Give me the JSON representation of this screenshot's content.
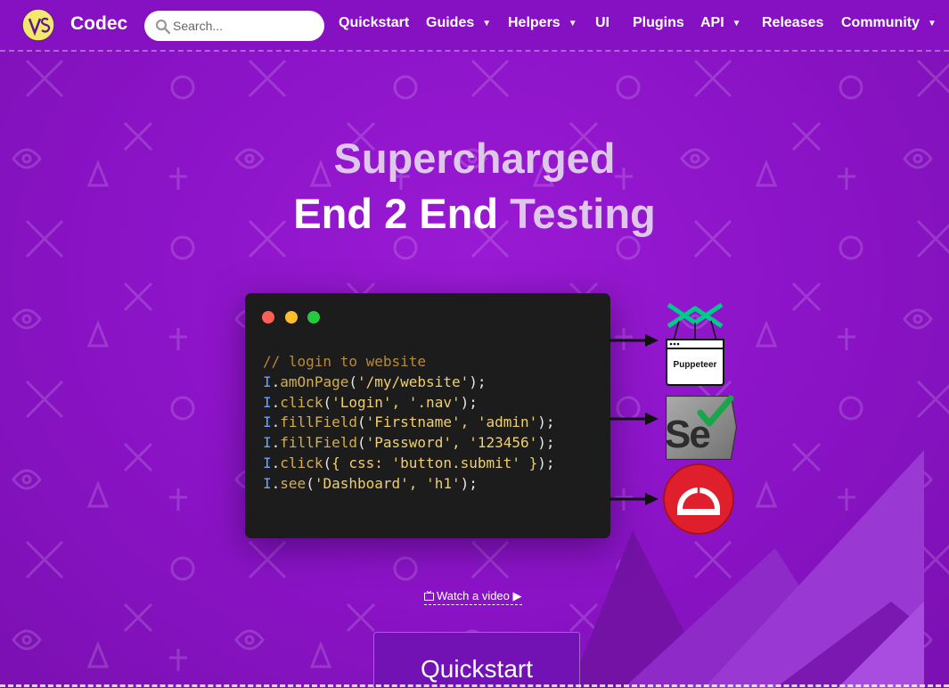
{
  "brand": {
    "name": "Codec"
  },
  "search": {
    "placeholder": "Search..."
  },
  "nav": {
    "items": [
      {
        "label": "Quickstart",
        "dropdown": false
      },
      {
        "label": "Guides",
        "dropdown": true
      },
      {
        "label": "Helpers",
        "dropdown": true
      },
      {
        "label": "UI",
        "dropdown": false
      },
      {
        "label": "Plugins",
        "dropdown": false
      },
      {
        "label": "API",
        "dropdown": true
      },
      {
        "label": "Releases",
        "dropdown": false
      },
      {
        "label": "Community",
        "dropdown": true
      }
    ],
    "caret": "▼"
  },
  "hero": {
    "line1": "Supercharged",
    "line2_part1": "End 2 End",
    "line2_part2": "Testing"
  },
  "code": {
    "comment": "// login to website",
    "lines": [
      {
        "obj": "I",
        "fn": "amOnPage",
        "args": "'/my/website'"
      },
      {
        "obj": "I",
        "fn": "click",
        "args": "'Login', '.nav'"
      },
      {
        "obj": "I",
        "fn": "fillField",
        "args": "'Firstname', 'admin'"
      },
      {
        "obj": "I",
        "fn": "fillField",
        "args": "'Password', '123456'"
      },
      {
        "obj": "I",
        "fn": "click",
        "args": "{ css: 'button.submit' }"
      },
      {
        "obj": "I",
        "fn": "see",
        "args": "'Dashboard', 'h1'"
      }
    ]
  },
  "logos": {
    "puppeteer_label": "Puppeteer",
    "selenium_label": "Se"
  },
  "video": {
    "label": "Watch a video ▶"
  },
  "cta": {
    "label": "Quickstart"
  },
  "colors": {
    "background": "#8a14c4",
    "hero_light": "#ddc8ea",
    "code_bg": "#1c1c1c",
    "dot_red": "#ff5f56",
    "dot_yellow": "#ffbd2e",
    "dot_green": "#27c93f"
  }
}
